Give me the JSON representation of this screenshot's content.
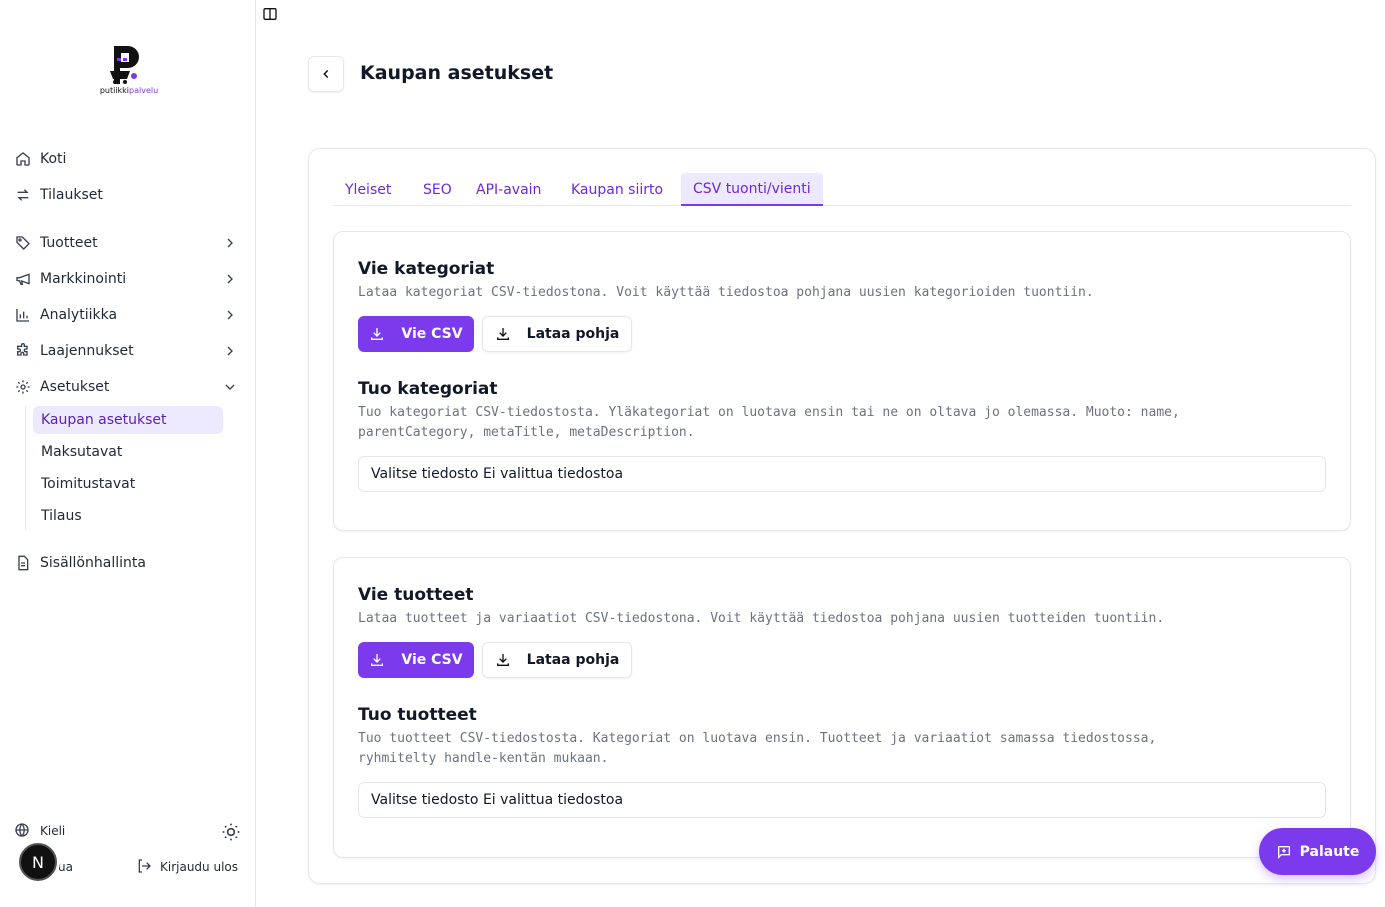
{
  "brand": {
    "logo_text_start": "putiikki",
    "logo_text_accent": "palvelu"
  },
  "sidebar": {
    "items": [
      {
        "label": "Koti"
      },
      {
        "label": "Tilaukset"
      },
      {
        "label": "Tuotteet"
      },
      {
        "label": "Markkinointi"
      },
      {
        "label": "Analytiikka"
      },
      {
        "label": "Laajennukset"
      },
      {
        "label": "Asetukset"
      },
      {
        "label": "Sisällönhallinta"
      }
    ],
    "sub_items": [
      {
        "label": "Kaupan asetukset"
      },
      {
        "label": "Maksutavat"
      },
      {
        "label": "Toimitustavat"
      },
      {
        "label": "Tilaus"
      }
    ],
    "language_label": "Kieli",
    "help_partial": "ua",
    "logout_label": "Kirjaudu ulos",
    "avatar_letter": "N"
  },
  "header": {
    "title": "Kaupan asetukset"
  },
  "tabs": [
    {
      "label": "Yleiset"
    },
    {
      "label": "SEO"
    },
    {
      "label": "API-avain"
    },
    {
      "label": "Kaupan siirto"
    },
    {
      "label": "CSV tuonti/vienti"
    }
  ],
  "sections": [
    {
      "export_title": "Vie kategoriat",
      "export_desc": "Lataa kategoriat CSV-tiedostona. Voit käyttää tiedostoa pohjana uusien kategorioiden tuontiin.",
      "export_button": "Vie CSV",
      "template_button": "Lataa pohja",
      "import_title": "Tuo kategoriat",
      "import_desc": "Tuo kategoriat CSV-tiedostosta. Yläkategoriat on luotava ensin tai ne on oltava jo olemassa. Muoto: name, parentCategory, metaTitle, metaDescription.",
      "file_button": "Valitse tiedosto",
      "file_status": "Ei valittua tiedostoa"
    },
    {
      "export_title": "Vie tuotteet",
      "export_desc": "Lataa tuotteet ja variaatiot CSV-tiedostona. Voit käyttää tiedostoa pohjana uusien tuotteiden tuontiin.",
      "export_button": "Vie CSV",
      "template_button": "Lataa pohja",
      "import_title": "Tuo tuotteet",
      "import_desc": "Tuo tuotteet CSV-tiedostosta. Kategoriat on luotava ensin. Tuotteet ja variaatiot samassa tiedostossa, ryhmitelty handle-kentän mukaan.",
      "file_button": "Valitse tiedosto",
      "file_status": "Ei valittua tiedostoa"
    }
  ],
  "feedback_label": "Palaute",
  "colors": {
    "accent": "#7c3aed",
    "accent_light": "#ede9fe"
  }
}
